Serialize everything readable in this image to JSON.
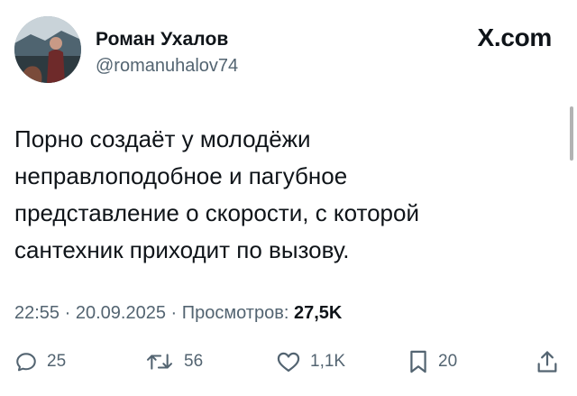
{
  "author": {
    "name": "Роман Ухалов",
    "handle": "@romanuhalov74"
  },
  "brand": "X.com",
  "tweet": {
    "lines": [
      "Порно создаёт у молодёжи",
      "неправлоподобное и пагубное",
      "представление о скорости, с которой",
      "сантехник приходит по вызову."
    ]
  },
  "meta": {
    "time": "22:55",
    "date": "20.09.2025",
    "separator": " · ",
    "views_label": "Просмотров:",
    "views_count": "27,5K"
  },
  "actions": {
    "replies": "25",
    "reposts": "56",
    "likes": "1,1K",
    "bookmarks": "20"
  },
  "icons": [
    "reply-icon",
    "repost-icon",
    "like-icon",
    "bookmark-icon",
    "share-icon"
  ],
  "colors": {
    "text": "#0f1419",
    "secondary": "#536471",
    "background": "#ffffff"
  }
}
